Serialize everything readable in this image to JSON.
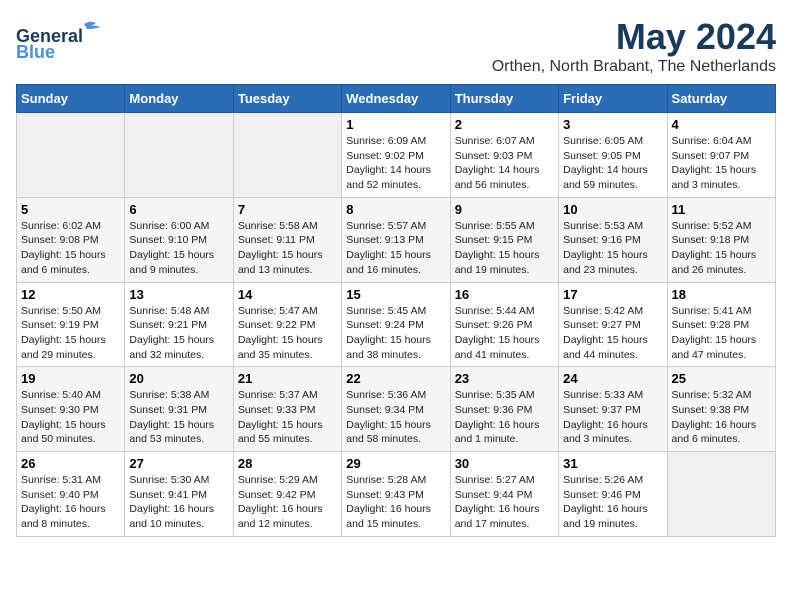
{
  "logo": {
    "line1": "General",
    "line2": "Blue"
  },
  "title": "May 2024",
  "location": "Orthen, North Brabant, The Netherlands",
  "days_of_week": [
    "Sunday",
    "Monday",
    "Tuesday",
    "Wednesday",
    "Thursday",
    "Friday",
    "Saturday"
  ],
  "weeks": [
    [
      {
        "day": "",
        "info": ""
      },
      {
        "day": "",
        "info": ""
      },
      {
        "day": "",
        "info": ""
      },
      {
        "day": "1",
        "info": "Sunrise: 6:09 AM\nSunset: 9:02 PM\nDaylight: 14 hours and 52 minutes."
      },
      {
        "day": "2",
        "info": "Sunrise: 6:07 AM\nSunset: 9:03 PM\nDaylight: 14 hours and 56 minutes."
      },
      {
        "day": "3",
        "info": "Sunrise: 6:05 AM\nSunset: 9:05 PM\nDaylight: 14 hours and 59 minutes."
      },
      {
        "day": "4",
        "info": "Sunrise: 6:04 AM\nSunset: 9:07 PM\nDaylight: 15 hours and 3 minutes."
      }
    ],
    [
      {
        "day": "5",
        "info": "Sunrise: 6:02 AM\nSunset: 9:08 PM\nDaylight: 15 hours and 6 minutes."
      },
      {
        "day": "6",
        "info": "Sunrise: 6:00 AM\nSunset: 9:10 PM\nDaylight: 15 hours and 9 minutes."
      },
      {
        "day": "7",
        "info": "Sunrise: 5:58 AM\nSunset: 9:11 PM\nDaylight: 15 hours and 13 minutes."
      },
      {
        "day": "8",
        "info": "Sunrise: 5:57 AM\nSunset: 9:13 PM\nDaylight: 15 hours and 16 minutes."
      },
      {
        "day": "9",
        "info": "Sunrise: 5:55 AM\nSunset: 9:15 PM\nDaylight: 15 hours and 19 minutes."
      },
      {
        "day": "10",
        "info": "Sunrise: 5:53 AM\nSunset: 9:16 PM\nDaylight: 15 hours and 23 minutes."
      },
      {
        "day": "11",
        "info": "Sunrise: 5:52 AM\nSunset: 9:18 PM\nDaylight: 15 hours and 26 minutes."
      }
    ],
    [
      {
        "day": "12",
        "info": "Sunrise: 5:50 AM\nSunset: 9:19 PM\nDaylight: 15 hours and 29 minutes."
      },
      {
        "day": "13",
        "info": "Sunrise: 5:48 AM\nSunset: 9:21 PM\nDaylight: 15 hours and 32 minutes."
      },
      {
        "day": "14",
        "info": "Sunrise: 5:47 AM\nSunset: 9:22 PM\nDaylight: 15 hours and 35 minutes."
      },
      {
        "day": "15",
        "info": "Sunrise: 5:45 AM\nSunset: 9:24 PM\nDaylight: 15 hours and 38 minutes."
      },
      {
        "day": "16",
        "info": "Sunrise: 5:44 AM\nSunset: 9:26 PM\nDaylight: 15 hours and 41 minutes."
      },
      {
        "day": "17",
        "info": "Sunrise: 5:42 AM\nSunset: 9:27 PM\nDaylight: 15 hours and 44 minutes."
      },
      {
        "day": "18",
        "info": "Sunrise: 5:41 AM\nSunset: 9:28 PM\nDaylight: 15 hours and 47 minutes."
      }
    ],
    [
      {
        "day": "19",
        "info": "Sunrise: 5:40 AM\nSunset: 9:30 PM\nDaylight: 15 hours and 50 minutes."
      },
      {
        "day": "20",
        "info": "Sunrise: 5:38 AM\nSunset: 9:31 PM\nDaylight: 15 hours and 53 minutes."
      },
      {
        "day": "21",
        "info": "Sunrise: 5:37 AM\nSunset: 9:33 PM\nDaylight: 15 hours and 55 minutes."
      },
      {
        "day": "22",
        "info": "Sunrise: 5:36 AM\nSunset: 9:34 PM\nDaylight: 15 hours and 58 minutes."
      },
      {
        "day": "23",
        "info": "Sunrise: 5:35 AM\nSunset: 9:36 PM\nDaylight: 16 hours and 1 minute."
      },
      {
        "day": "24",
        "info": "Sunrise: 5:33 AM\nSunset: 9:37 PM\nDaylight: 16 hours and 3 minutes."
      },
      {
        "day": "25",
        "info": "Sunrise: 5:32 AM\nSunset: 9:38 PM\nDaylight: 16 hours and 6 minutes."
      }
    ],
    [
      {
        "day": "26",
        "info": "Sunrise: 5:31 AM\nSunset: 9:40 PM\nDaylight: 16 hours and 8 minutes."
      },
      {
        "day": "27",
        "info": "Sunrise: 5:30 AM\nSunset: 9:41 PM\nDaylight: 16 hours and 10 minutes."
      },
      {
        "day": "28",
        "info": "Sunrise: 5:29 AM\nSunset: 9:42 PM\nDaylight: 16 hours and 12 minutes."
      },
      {
        "day": "29",
        "info": "Sunrise: 5:28 AM\nSunset: 9:43 PM\nDaylight: 16 hours and 15 minutes."
      },
      {
        "day": "30",
        "info": "Sunrise: 5:27 AM\nSunset: 9:44 PM\nDaylight: 16 hours and 17 minutes."
      },
      {
        "day": "31",
        "info": "Sunrise: 5:26 AM\nSunset: 9:46 PM\nDaylight: 16 hours and 19 minutes."
      },
      {
        "day": "",
        "info": ""
      }
    ]
  ]
}
